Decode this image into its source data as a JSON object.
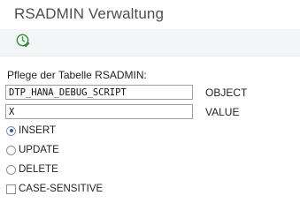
{
  "window": {
    "title": "RSADMIN Verwaltung"
  },
  "toolbar": {
    "execute_icon": "execute-clock-check-icon",
    "icon_color": "#2e8b3a"
  },
  "form": {
    "section_label": "Pflege der Tabelle RSADMIN:",
    "object_value": "DTP_HANA_DEBUG_SCRIPT",
    "object_label": "OBJECT",
    "value_value": "X",
    "value_label": "VALUE"
  },
  "options": {
    "insert": "INSERT",
    "update": "UPDATE",
    "delete": "DELETE",
    "selected": "INSERT"
  },
  "case_sensitive": {
    "label": "CASE-SENSITIVE",
    "checked": false
  },
  "colors": {
    "title_text": "#4a4f55",
    "toolbar_bg": "#f4f5f6",
    "radio_dot": "#2a5db0"
  }
}
